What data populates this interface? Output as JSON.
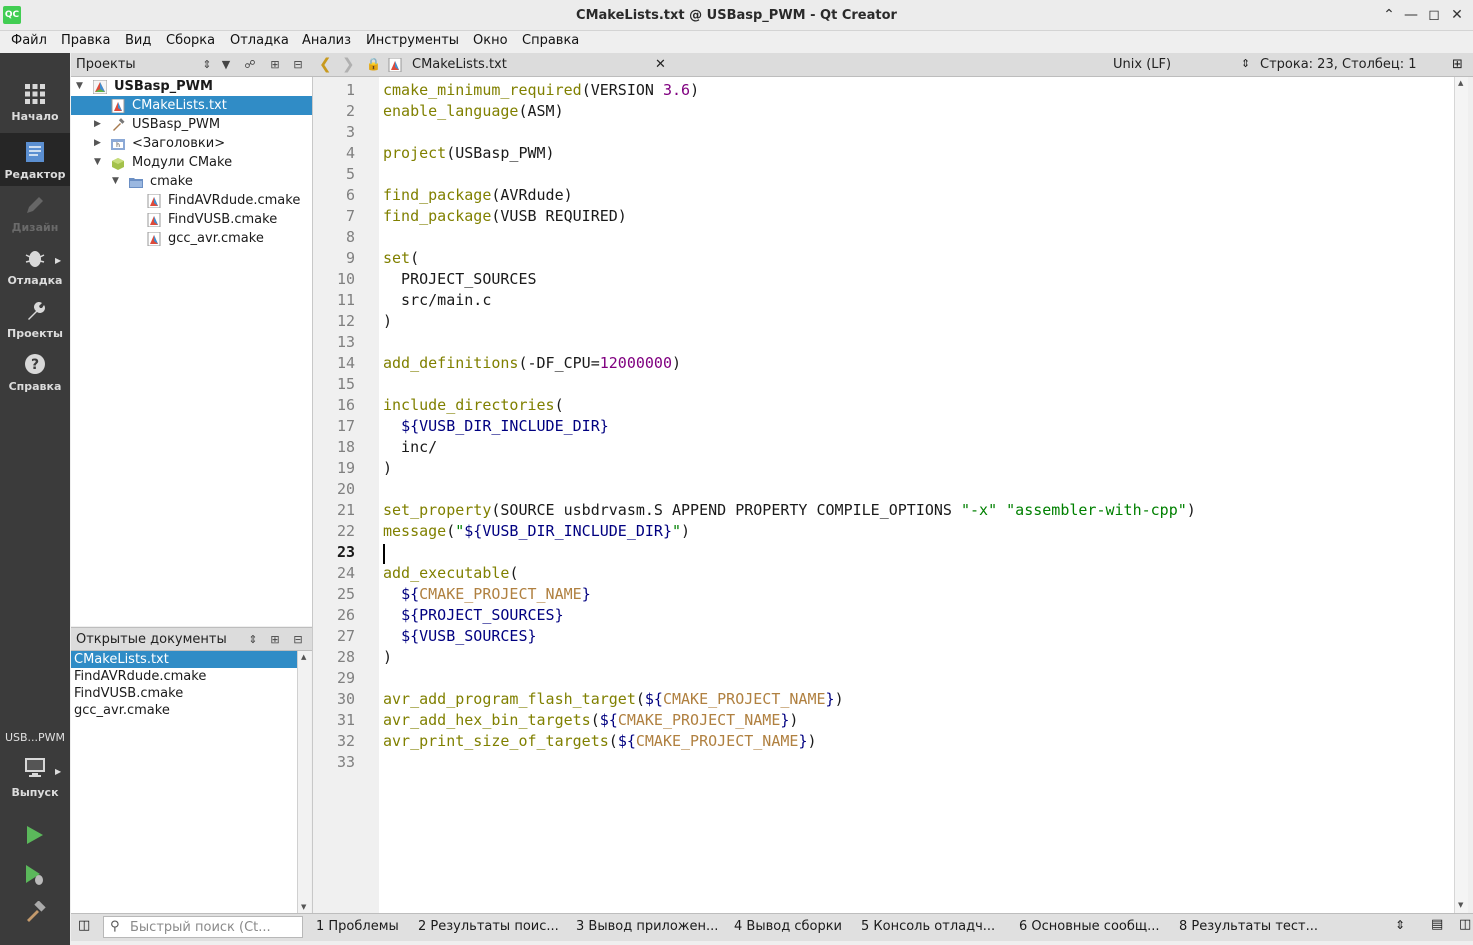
{
  "window": {
    "title": "CMakeLists.txt @ USBasp_PWM - Qt Creator",
    "app_icon": "QC"
  },
  "menu": [
    "Файл",
    "Правка",
    "Вид",
    "Сборка",
    "Отладка",
    "Анализ",
    "Инструменты",
    "Окно",
    "Справка"
  ],
  "modes": {
    "welcome": "Начало",
    "editor": "Редактор",
    "design": "Дизайн",
    "debug": "Отладка",
    "projects": "Проекты",
    "help": "Справка",
    "kit_name": "USB...PWM",
    "kit_config": "Выпуск"
  },
  "projects_pane": {
    "title": "Проекты",
    "tree": [
      {
        "label": "USBasp_PWM",
        "icon": "cmake-project-icon"
      },
      {
        "label": "CMakeLists.txt",
        "icon": "cmake-file-icon"
      },
      {
        "label": "USBasp_PWM",
        "icon": "build-target-icon"
      },
      {
        "label": "<Заголовки>",
        "icon": "headers-icon"
      },
      {
        "label": "Модули CMake",
        "icon": "cmake-modules-icon"
      },
      {
        "label": "cmake",
        "icon": "folder-icon"
      },
      {
        "label": "FindAVRdude.cmake",
        "icon": "cmake-file-icon"
      },
      {
        "label": "FindVUSB.cmake",
        "icon": "cmake-file-icon"
      },
      {
        "label": "gcc_avr.cmake",
        "icon": "cmake-file-icon"
      }
    ]
  },
  "open_docs": {
    "title": "Открытые документы",
    "items": [
      "CMakeLists.txt",
      "FindAVRdude.cmake",
      "FindVUSB.cmake",
      "gcc_avr.cmake"
    ]
  },
  "editor": {
    "file_name": "CMakeLists.txt",
    "line_endings": "Unix (LF)",
    "position": "Строка: 23, Столбец: 1",
    "current_line": 23,
    "line_numbers": [
      "1",
      "2",
      "3",
      "4",
      "5",
      "6",
      "7",
      "8",
      "9",
      "10",
      "11",
      "12",
      "13",
      "14",
      "15",
      "16",
      "17",
      "18",
      "19",
      "20",
      "21",
      "22",
      "23",
      "24",
      "25",
      "26",
      "27",
      "28",
      "29",
      "30",
      "31",
      "32",
      "33"
    ]
  },
  "code_tokens": {
    "l1": [
      "cmake_minimum_required",
      "(VERSION ",
      "3.6",
      ")"
    ],
    "l2": [
      "enable_language",
      "(ASM)"
    ],
    "l4": [
      "project",
      "(USBasp_PWM)"
    ],
    "l6": [
      "find_package",
      "(AVRdude)"
    ],
    "l7": [
      "find_package",
      "(VUSB REQUIRED)"
    ],
    "l9": [
      "set",
      "("
    ],
    "l10": [
      "  PROJECT_SOURCES"
    ],
    "l11": [
      "  src/main.c"
    ],
    "l12": [
      ")"
    ],
    "l14": [
      "add_definitions",
      "(-DF_CPU=",
      "12000000",
      ")"
    ],
    "l16": [
      "include_directories",
      "("
    ],
    "l17": [
      "  ",
      "${VUSB_DIR_INCLUDE_DIR}"
    ],
    "l18": [
      "  inc/"
    ],
    "l19": [
      ")"
    ],
    "l21": [
      "set_property",
      "(SOURCE usbdrvasm.S APPEND PROPERTY COMPILE_OPTIONS ",
      "\"-x\"",
      " ",
      "\"assembler-with-cpp\"",
      ")"
    ],
    "l22": [
      "message",
      "(",
      "\"",
      "${VUSB_DIR_INCLUDE_DIR}",
      "\"",
      ")"
    ],
    "l24": [
      "add_executable",
      "("
    ],
    "l25": [
      "  ",
      "${",
      "CMAKE_PROJECT_NAME",
      "}"
    ],
    "l26": [
      "  ",
      "${PROJECT_SOURCES}"
    ],
    "l27": [
      "  ",
      "${VUSB_SOURCES}"
    ],
    "l28": [
      ")"
    ],
    "l30": [
      "avr_add_program_flash_target",
      "(",
      "${",
      "CMAKE_PROJECT_NAME",
      "}",
      ")"
    ],
    "l31": [
      "avr_add_hex_bin_targets",
      "(",
      "${",
      "CMAKE_PROJECT_NAME",
      "}",
      ")"
    ],
    "l32": [
      "avr_print_size_of_targets",
      "(",
      "${",
      "CMAKE_PROJECT_NAME",
      "}",
      ")"
    ]
  },
  "statusbar": {
    "search_placeholder": "Быстрый поиск (Ct...",
    "tabs": [
      "1  Проблемы",
      "2  Результаты поис...",
      "3  Вывод приложен...",
      "4  Вывод сборки",
      "5  Консоль отладч...",
      "6  Основные сообщ...",
      "8  Результаты тест..."
    ]
  },
  "colors": {
    "accent": "#308cc6",
    "modebar": "#3b3b3b",
    "keyword": "#808000",
    "number": "#800080",
    "variable": "#000080",
    "string": "#008000",
    "cmake_var": "#b08040"
  }
}
